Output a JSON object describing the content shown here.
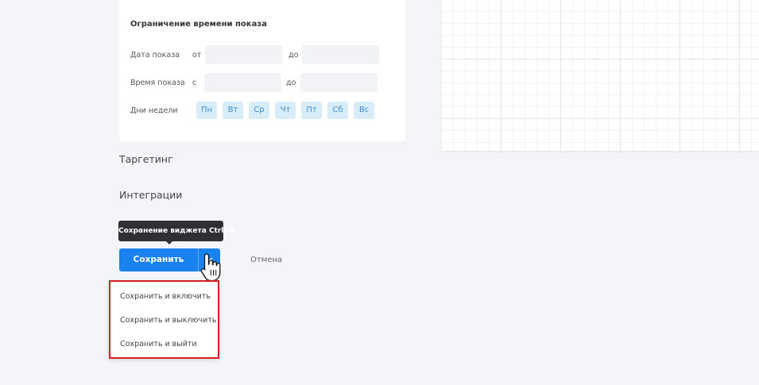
{
  "display_time": {
    "title": "Ограничение времени показа",
    "date_label": "Дата показа",
    "date_from": "от",
    "date_to": "до",
    "time_label": "Время показа",
    "time_from": "с",
    "time_to": "до",
    "weekdays_label": "Дни недели",
    "weekdays": [
      "Пн",
      "Вт",
      "Ср",
      "Чт",
      "Пт",
      "Сб",
      "Вс"
    ]
  },
  "sections": {
    "targeting": "Таргетинг",
    "integrations": "Интеграции"
  },
  "save": {
    "tooltip": "Сохранение виджета Ctrl+S",
    "label": "Сохранить",
    "cancel": "Отмена",
    "menu": [
      "Сохранить и включить",
      "Сохранить и выключить",
      "Сохранить и выйти"
    ]
  },
  "colors": {
    "primary": "#1a82f0",
    "highlight_border": "#d32020",
    "day_bg": "#d9ecfa"
  }
}
